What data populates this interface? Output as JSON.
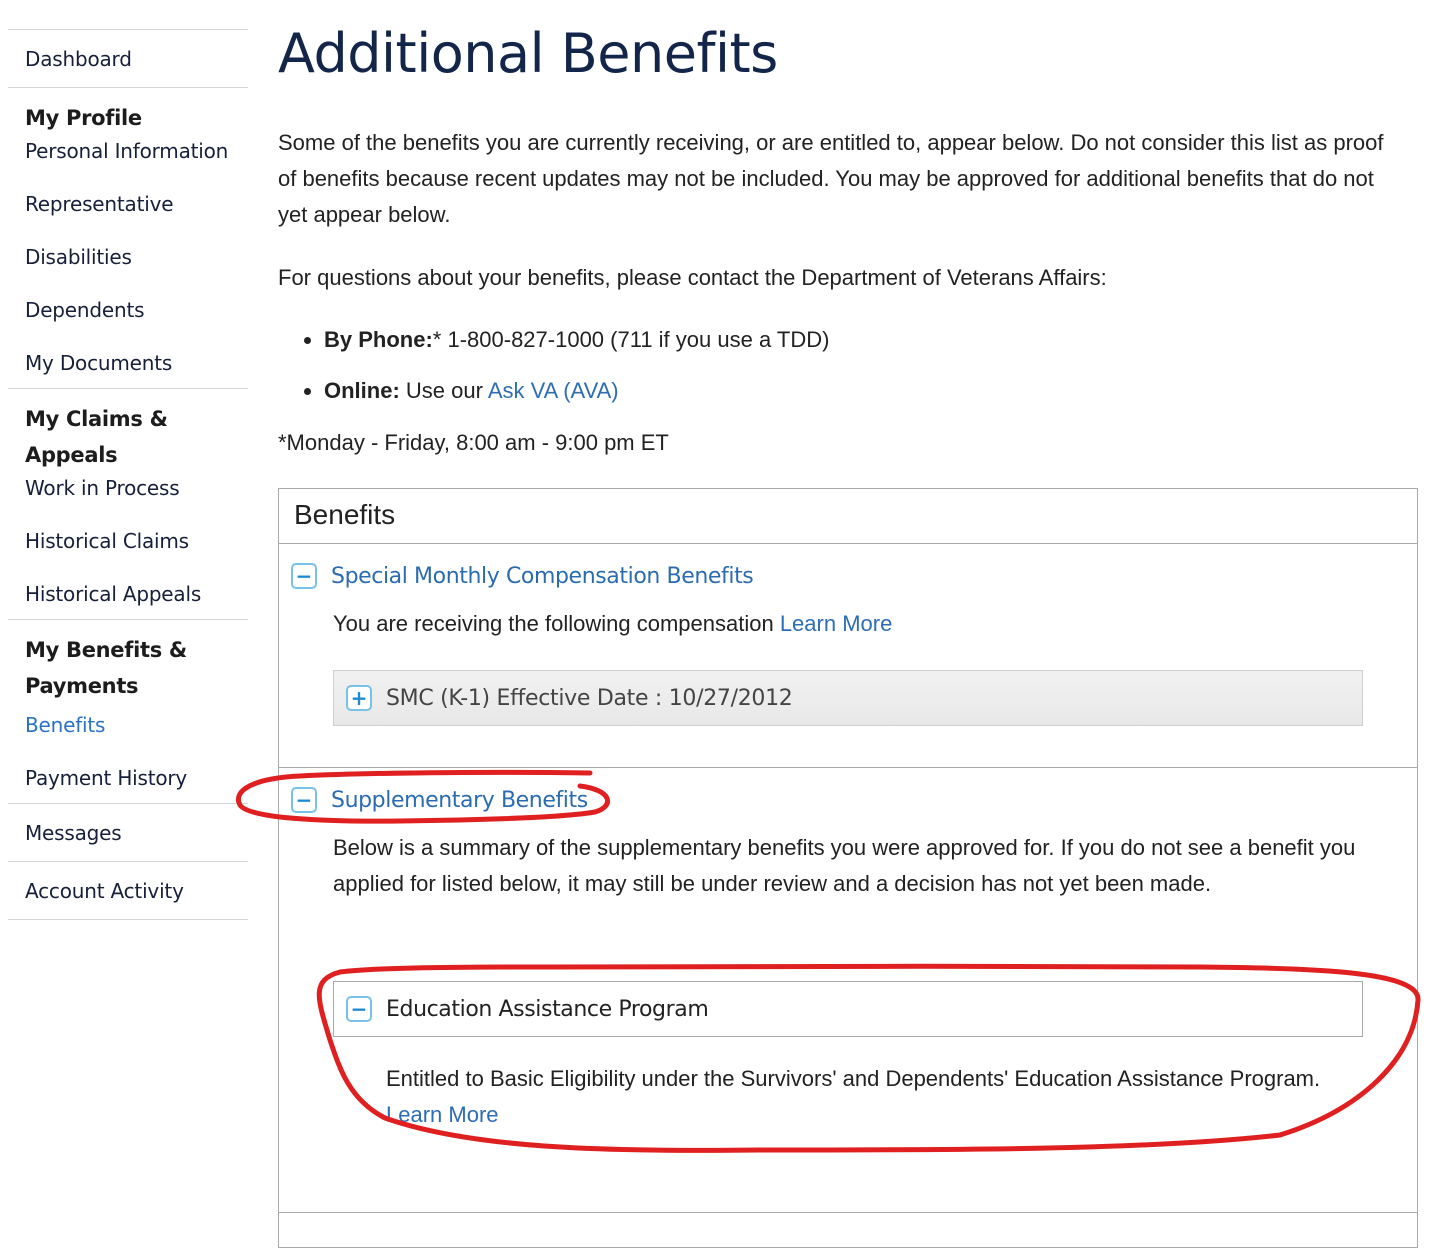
{
  "sidebar": {
    "dashboard": "Dashboard",
    "groups": [
      {
        "heading": "My Profile",
        "items": [
          "Personal Information",
          "Representative",
          "Disabilities",
          "Dependents",
          "My Documents"
        ]
      },
      {
        "heading": "My Claims & Appeals",
        "items": [
          "Work in Process",
          "Historical Claims",
          "Historical Appeals"
        ]
      },
      {
        "heading_line1": "My Benefits &",
        "heading_line2": "Payments",
        "items": [
          "Benefits",
          "Payment History"
        ],
        "active": "Benefits"
      }
    ],
    "messages": "Messages",
    "account_activity": "Account Activity"
  },
  "main": {
    "title": "Additional Benefits",
    "intro": "Some of the benefits you are currently receiving, or are entitled to, appear below. Do not consider this list as proof of benefits because recent updates may not be included. You may be approved for additional benefits that do not yet appear below.",
    "contact_text": "For questions about your benefits, please contact the Department of Veterans Affairs:",
    "phone_label": "By Phone:",
    "phone_value": "* 1-800-827-1000 (711 if you use a TDD)",
    "online_label": "Online:",
    "online_prefix": " Use our ",
    "online_link": "Ask VA (AVA)",
    "hours": "*Monday - Friday, 8:00 am - 9:00 pm ET"
  },
  "benefits_panel": {
    "title": "Benefits",
    "smc": {
      "title": "Special Monthly Compensation Benefits",
      "toggle": "−",
      "text": "You are receiving the following compensation ",
      "learn_more": "Learn More",
      "item_toggle": "+",
      "item": "SMC (K-1) Effective Date : 10/27/2012"
    },
    "supplementary": {
      "title": "Supplementary Benefits",
      "toggle": "−",
      "text": "Below is a summary of the supplementary benefits you were approved for. If you do not see a benefit you applied for listed below, it may still be under review and a decision has not yet been made.",
      "program": {
        "toggle": "−",
        "title": "Education Assistance Program",
        "text": "Entitled to Basic Eligibility under the Survivors' and Dependents' Education Assistance Program. ",
        "learn_more": "Learn More"
      }
    }
  },
  "colors": {
    "link": "#2b6cb0",
    "title": "#13264a",
    "annotation": "#e02020",
    "toggle_border": "#78c2ea"
  }
}
